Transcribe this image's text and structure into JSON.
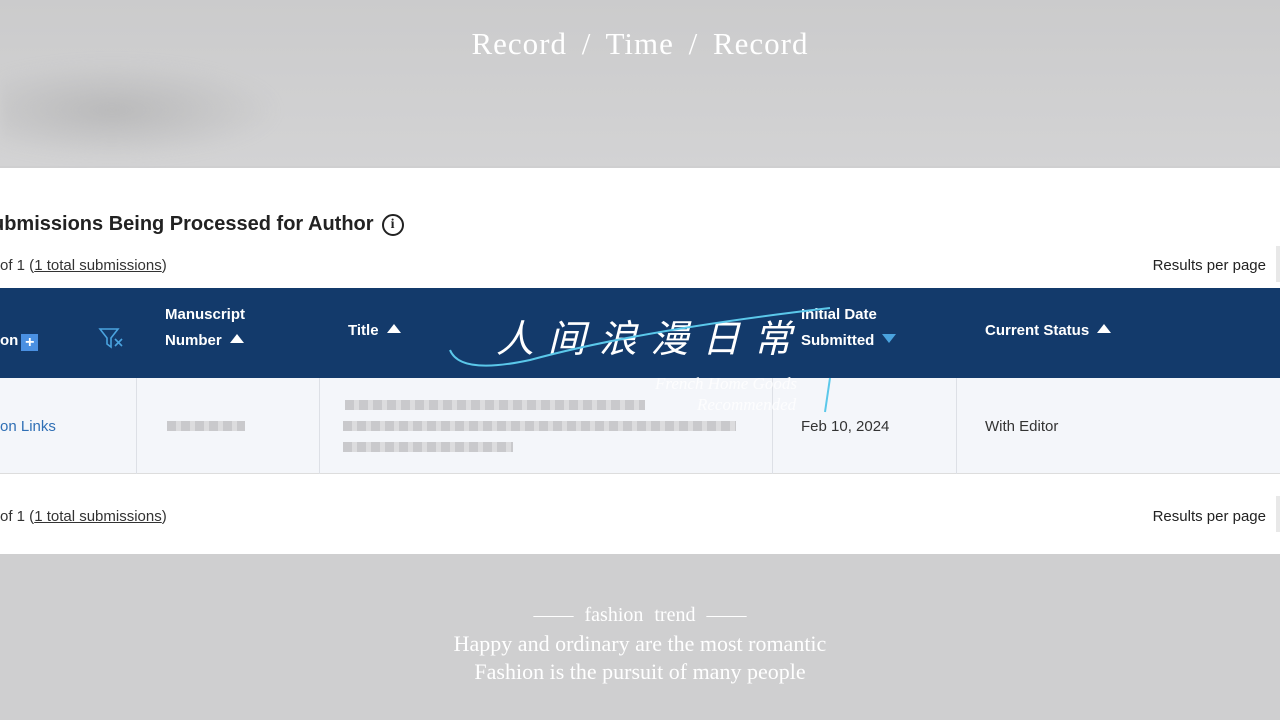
{
  "overlay": {
    "header_title": "Record  /  Time  /  Record",
    "chinese_title": "人 间 浪 漫 日 常",
    "sub_line1": "French Home Goods",
    "sub_line2": "Recommended",
    "footer_tag": "—— fashion trend ——",
    "footer_line1": "Happy and ordinary are the most romantic",
    "footer_line2": "Fashion is the pursuit of many people",
    "accent": "#5bc8ea"
  },
  "page": {
    "heading": "ubmissions Being Processed for Author",
    "pager_prefix": "of 1 (",
    "pager_link": "1 total submissions",
    "pager_suffix": ")",
    "results_per_page": "Results per page",
    "columns": [
      {
        "label": "on"
      },
      {
        "label": "Manuscript"
      },
      {
        "label": "Number"
      },
      {
        "label": "Title"
      },
      {
        "label": "Initial Date"
      },
      {
        "label": "Submitted"
      },
      {
        "label": "Current Status"
      }
    ],
    "row": {
      "action_link": "on Links",
      "date": "Feb 10, 2024",
      "status": "With Editor"
    },
    "header_color": "#133a6b"
  }
}
